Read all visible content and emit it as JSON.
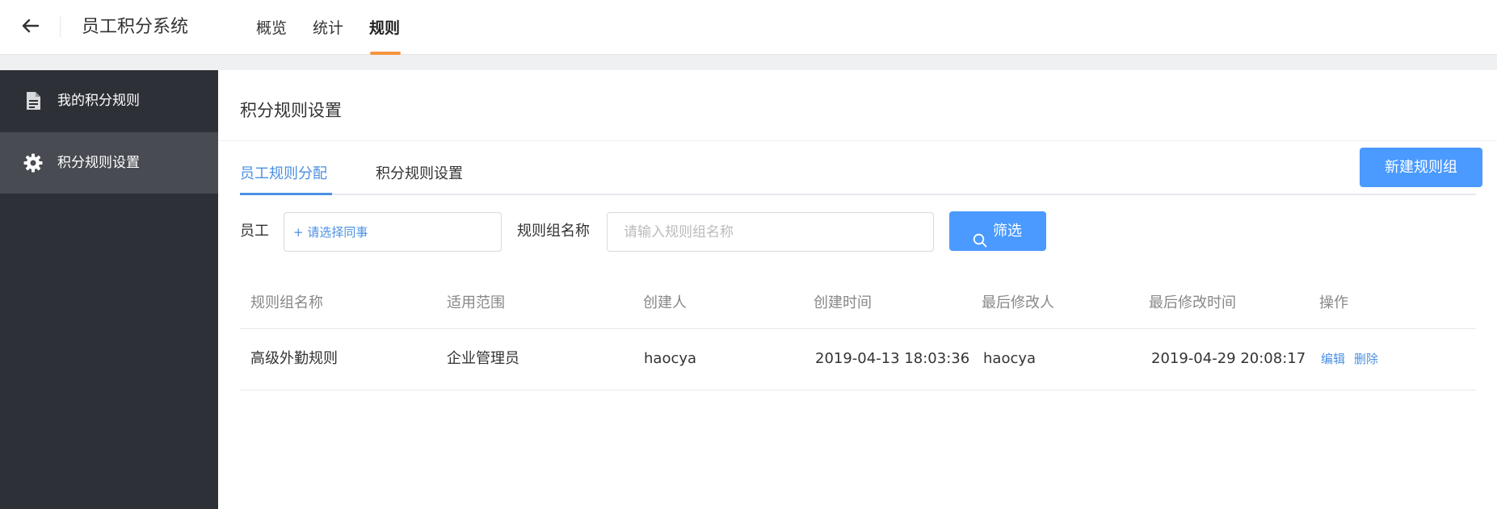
{
  "header": {
    "app_title": "员工积分系统",
    "nav": [
      {
        "label": "概览",
        "active": false
      },
      {
        "label": "统计",
        "active": false
      },
      {
        "label": "规则",
        "active": true
      }
    ],
    "accent_color": "#f5943f"
  },
  "sidebar": {
    "items": [
      {
        "label": "我的积分规则",
        "icon": "document-icon",
        "active": false
      },
      {
        "label": "积分规则设置",
        "icon": "gear-icon",
        "active": true
      }
    ]
  },
  "main": {
    "page_title": "积分规则设置",
    "tabs": [
      {
        "label": "员工规则分配",
        "active": true
      },
      {
        "label": "积分规则设置",
        "active": false
      }
    ],
    "new_group_button": "新建规则组",
    "filters": {
      "employee_label": "员工",
      "employee_picker_text": "+ 请选择同事",
      "group_name_label": "规则组名称",
      "group_name_placeholder": "请输入规则组名称",
      "filter_button": "筛选"
    },
    "table": {
      "columns": [
        "规则组名称",
        "适用范围",
        "创建人",
        "创建时间",
        "最后修改人",
        "最后修改时间",
        "操作"
      ],
      "rows": [
        {
          "name": "高级外勤规则",
          "scope": "企业管理员",
          "creator": "haocya",
          "created_at": "2019-04-13 18:03:36",
          "modifier": "haocya",
          "modified_at": "2019-04-29 20:08:17",
          "actions": [
            "编辑",
            "删除"
          ]
        }
      ]
    },
    "primary_color": "#4a9aff"
  }
}
